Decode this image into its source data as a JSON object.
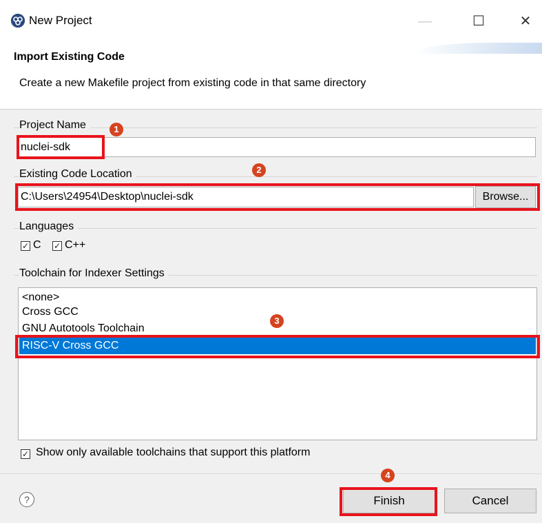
{
  "window": {
    "title": "New Project",
    "minimize_glyph": "—",
    "maximize_glyph": "☐",
    "close_glyph": "✕"
  },
  "banner": {
    "title": "Import Existing Code",
    "description": "Create a new Makefile project from existing code in that same directory"
  },
  "project_name": {
    "label": "Project Name",
    "value": "nuclei-sdk"
  },
  "code_location": {
    "label": "Existing Code Location",
    "value": "C:\\Users\\24954\\Desktop\\nuclei-sdk",
    "browse_label": "Browse..."
  },
  "languages": {
    "label": "Languages",
    "items": [
      {
        "label": "C",
        "checked": true
      },
      {
        "label": "C++",
        "checked": true
      }
    ]
  },
  "toolchain": {
    "label": "Toolchain for Indexer Settings",
    "items": [
      "<none>",
      "Cross GCC",
      "GNU Autotools Toolchain",
      "RISC-V Cross GCC"
    ],
    "selected_index": 3,
    "filter_label": "Show only available toolchains that support this platform",
    "filter_checked": true
  },
  "annotations": [
    "1",
    "2",
    "3",
    "4"
  ],
  "footer": {
    "help_glyph": "?",
    "finish_label": "Finish",
    "cancel_label": "Cancel"
  },
  "colors": {
    "accent": "#0078d7",
    "highlight_red": "#e8141c",
    "badge": "#d5431f"
  }
}
